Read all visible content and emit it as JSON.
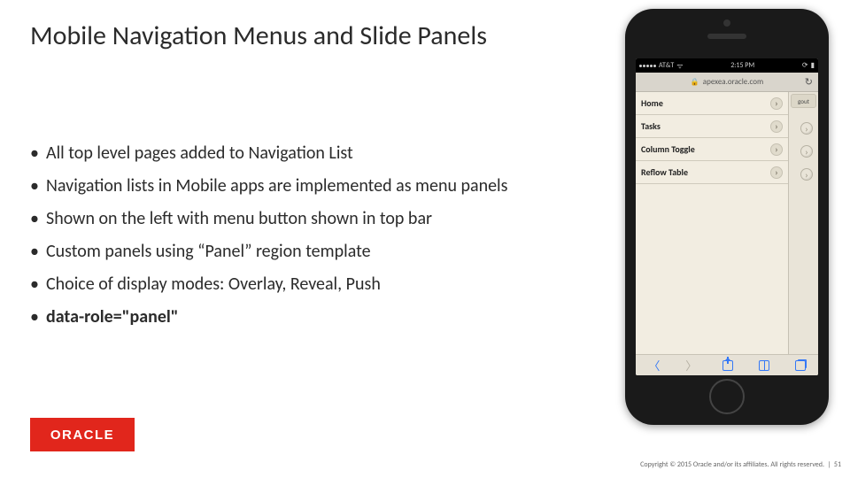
{
  "title": "Mobile Navigation Menus and Slide Panels",
  "bullets": [
    "All top level pages added to Navigation List",
    "Navigation lists in Mobile apps are implemented as menu panels",
    "Shown on the left with menu button shown in top bar",
    "Custom panels using “Panel” region template",
    "Choice of display modes: Overlay, Reveal, Push",
    "data-role=\"panel\""
  ],
  "logo": "ORACLE",
  "footer": {
    "copyright": "Copyright © 2015 Oracle and/or its affiliates. All rights reserved.",
    "page": "51"
  },
  "phone": {
    "status": {
      "carrier": "AT&T",
      "time": "2:15 PM"
    },
    "url": "apexea.oracle.com",
    "app_right": {
      "logout": "gout"
    },
    "menu_items": [
      "Home",
      "Tasks",
      "Column Toggle",
      "Reflow Table"
    ]
  }
}
